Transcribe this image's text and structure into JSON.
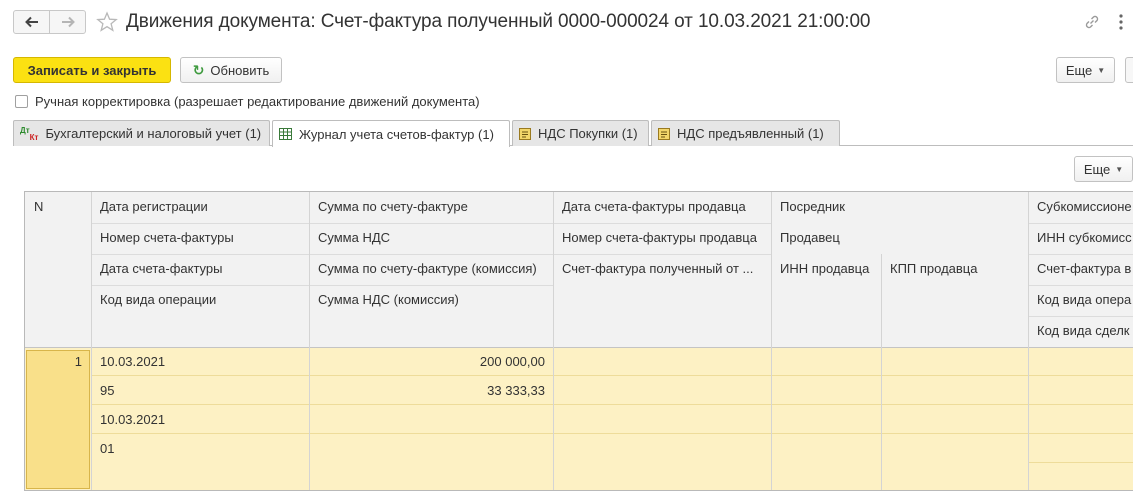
{
  "window": {
    "title": "Движения документа: Счет-фактура полученный 0000-000024 от 10.03.2021 21:00:00"
  },
  "toolbar": {
    "save_close_label": "Записать и закрыть",
    "refresh_label": "Обновить",
    "more_label": "Еще"
  },
  "manual_edit": {
    "label": "Ручная корректировка (разрешает редактирование движений документа)",
    "checked": false
  },
  "tabs": [
    {
      "label": "Бухгалтерский и налоговый учет (1)",
      "icon": "dt-kt-icon",
      "active": false
    },
    {
      "label": "Журнал учета счетов-фактур (1)",
      "icon": "table-icon",
      "active": true
    },
    {
      "label": "НДС Покупки (1)",
      "icon": "register-icon",
      "active": false
    },
    {
      "label": "НДС предъявленный (1)",
      "icon": "register-icon",
      "active": false
    }
  ],
  "table": {
    "more_label": "Еще",
    "headers": {
      "n": "N",
      "col1": [
        "Дата регистрации",
        "Номер счета-фактуры",
        "Дата счета-фактуры",
        "Код вида операции"
      ],
      "col2": [
        "Сумма по счету-фактуре",
        "Сумма НДС",
        "Сумма по счету-фактуре (комиссия)",
        "Сумма НДС (комиссия)"
      ],
      "col3": [
        "Дата счета-фактуры продавца",
        "Номер счета-фактуры продавца",
        "Счет-фактура полученный от ..."
      ],
      "col4": [
        "Посредник",
        "Продавец"
      ],
      "col4_split": [
        "ИНН продавца",
        "КПП продавца"
      ],
      "col5": [
        "Субкомиссионе",
        "ИНН субкомисс",
        "Счет-фактура в",
        "Код вида опера",
        "Код вида сделк"
      ]
    },
    "rows": [
      {
        "n": "1",
        "col1": [
          "10.03.2021",
          "95",
          "10.03.2021",
          "01"
        ],
        "col2": [
          "200 000,00",
          "33 333,33",
          "",
          ""
        ]
      }
    ]
  },
  "colors": {
    "primary_button": "#fbe112",
    "selected_row": "#fdf1c4",
    "selected_cell": "#f9e08a"
  }
}
